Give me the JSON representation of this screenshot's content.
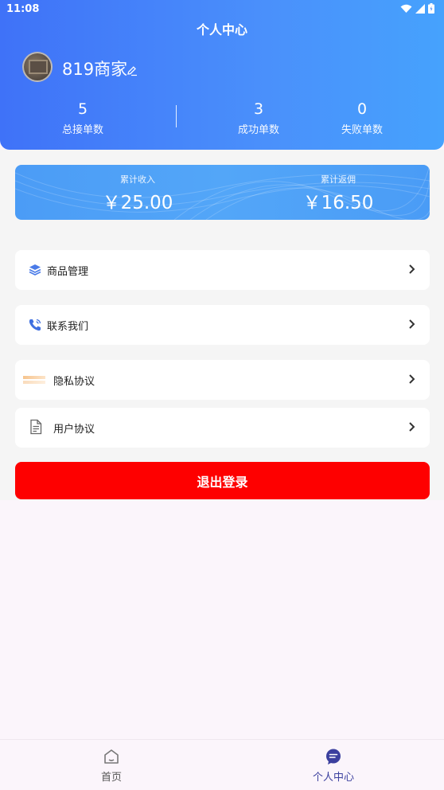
{
  "status_bar": {
    "time": "11:08"
  },
  "header": {
    "title": "个人中心",
    "username": "819商家",
    "stats": [
      {
        "value": "5",
        "label": "总接单数"
      },
      {
        "value": "3",
        "label": "成功单数"
      },
      {
        "value": "0",
        "label": "失败单数"
      }
    ]
  },
  "income": {
    "total_income_label": "累计收入",
    "total_income_value": "￥25.00",
    "total_rebate_label": "累计返佣",
    "total_rebate_value": "￥16.50"
  },
  "menu": {
    "items": [
      {
        "label": "商品管理",
        "icon": "layers-icon"
      },
      {
        "label": "联系我们",
        "icon": "phone-icon"
      },
      {
        "label": "隐私协议",
        "icon": "privacy-icon"
      },
      {
        "label": "用户协议",
        "icon": "document-icon"
      }
    ]
  },
  "logout": {
    "label": "退出登录"
  },
  "bottom_nav": {
    "items": [
      {
        "label": "首页",
        "icon": "home-icon"
      },
      {
        "label": "个人中心",
        "icon": "chat-icon"
      }
    ],
    "active_color": "#3b3f9e"
  },
  "colors": {
    "header_gradient_start": "#3f72f8",
    "header_gradient_end": "#46a2fd",
    "logout": "#fe0000",
    "card_blue": "#4b9cf6"
  }
}
